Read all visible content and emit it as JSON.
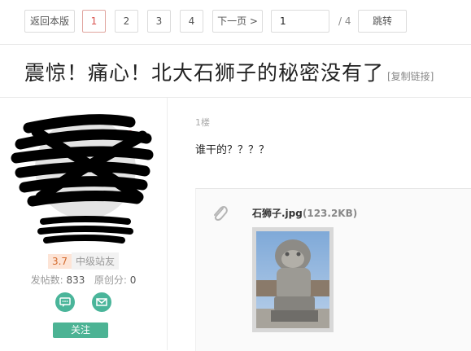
{
  "pager": {
    "back_label": "返回本版",
    "pages": [
      "1",
      "2",
      "3",
      "4"
    ],
    "next_label": "下一页 >",
    "page_input_value": "1",
    "total_label": "/ 4",
    "jump_label": "跳转"
  },
  "thread": {
    "title": "震惊！痛心！北大石狮子的秘密没有了",
    "copy_link_label": "[复制链接]"
  },
  "user": {
    "level": "3.7",
    "rank": "中级站友",
    "posts_label": "发帖数:",
    "posts": "833",
    "original_label": "原创分:",
    "original": "0",
    "follow_label": "关注"
  },
  "post": {
    "floor": "1楼",
    "text": "谁干的？？？？",
    "attachment_name": "石狮子.jpg",
    "attachment_size": "(123.2KB)"
  },
  "colors": {
    "accent_green": "#4cb394",
    "active_page_red": "#d9534f",
    "level_orange": "#d46a2c"
  }
}
